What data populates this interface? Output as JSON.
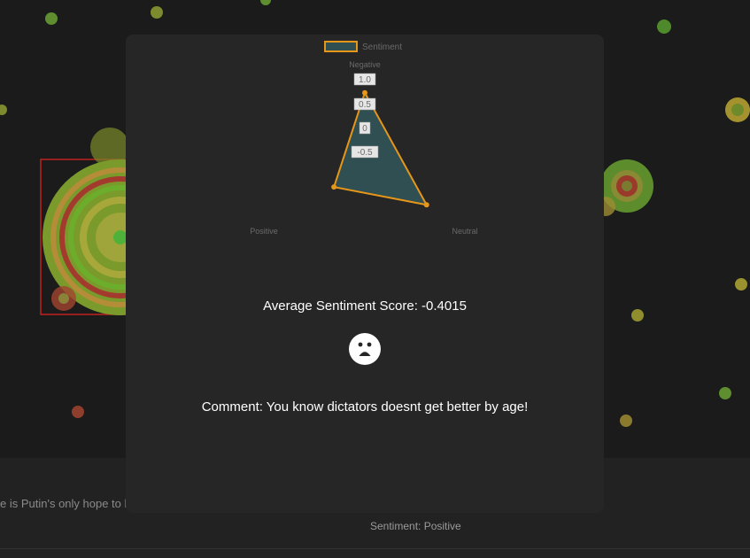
{
  "background": {
    "comment_snippet": "e is Putin's only hope to h",
    "sentiment_label": "Sentiment: Positive"
  },
  "modal": {
    "average_label": "Average Sentiment Score: -0.4015",
    "face_icon": "sad-face-icon",
    "comment": "Comment: You know dictators doesnt get better by age!"
  },
  "chart_data": {
    "type": "radar",
    "legend": "Sentiment",
    "axes": [
      "Negative",
      "Neutral",
      "Positive"
    ],
    "ticks": [
      "1.0",
      "0.5",
      "0",
      "-0.5"
    ],
    "range": [
      -1.0,
      1.0
    ],
    "series": [
      {
        "name": "Sentiment",
        "values": [
          0.5,
          0.4,
          -0.3
        ]
      }
    ],
    "colors": {
      "stroke": "#e69618",
      "fill": "#2f4f52"
    }
  }
}
